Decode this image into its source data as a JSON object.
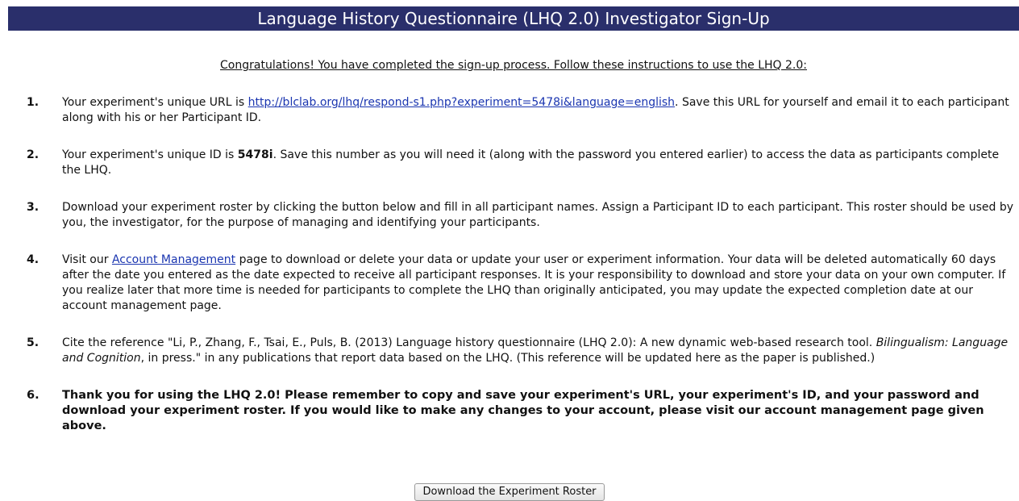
{
  "header": {
    "title": "Language History Questionnaire (LHQ 2.0) Investigator Sign-Up"
  },
  "intro": "Congratulations! You have completed the sign-up process. Follow these instructions to use the LHQ 2.0:",
  "steps": [
    {
      "num": "1.",
      "pre": "Your experiment's unique URL is ",
      "link": "http://blclab.org/lhq/respond-s1.php?experiment=5478i&language=english",
      "post": ". Save this URL for yourself and email it to each participant along with his or her Participant ID."
    },
    {
      "num": "2.",
      "pre": "Your experiment's unique ID is ",
      "id_value": "5478i",
      "post": ". Save this number as you will need it (along with the password you entered earlier) to access the data as participants complete the LHQ."
    },
    {
      "num": "3.",
      "text": "Download your experiment roster by clicking the button below and fill in all participant names. Assign a Participant ID to each participant. This roster should be used by you, the investigator, for the purpose of managing and identifying your participants."
    },
    {
      "num": "4.",
      "pre": "Visit our ",
      "link": "Account Management",
      "post": " page to download or delete your data or update your user or experiment information. Your data will be deleted automatically 60 days after the date you entered as the date expected to receive all participant responses. It is your responsibility to download and store your data on your own computer. If you realize later that more time is needed for participants to complete the LHQ than originally anticipated, you may update the expected completion date at our account management page."
    },
    {
      "num": "5.",
      "pre": "Cite the reference \"Li, P., Zhang, F., Tsai, E., Puls, B. (2013) Language history questionnaire (LHQ 2.0): A new dynamic web-based research tool. ",
      "journal": "Bilingualism: Language and Cognition",
      "post": ", in press.\" in any publications that report data based on the LHQ. (This reference will be updated here as the paper is published.)"
    },
    {
      "num": "6.",
      "text": "Thank you for using the LHQ 2.0! Please remember to copy and save your experiment's URL, your experiment's ID, and your password and download your experiment roster. If you would like to make any changes to your account, please visit our account management page given above."
    }
  ],
  "download_button": {
    "label": "Download the Experiment Roster"
  },
  "colors": {
    "header_bg": "#2a2f6b",
    "link": "#1a35b0"
  }
}
